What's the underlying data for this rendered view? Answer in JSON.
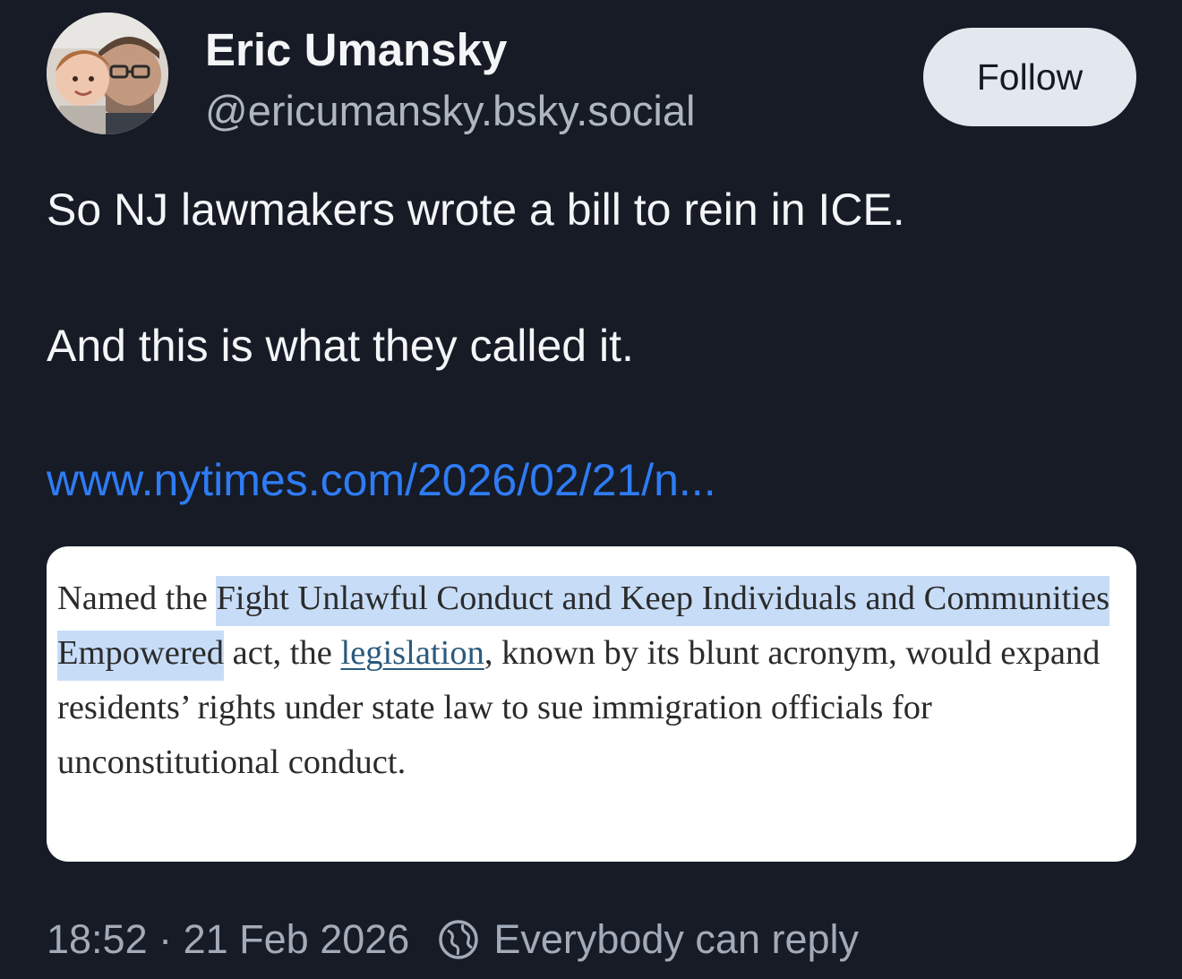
{
  "author": {
    "display_name": "Eric Umansky",
    "handle": "@ericumansky.bsky.social",
    "avatar_icon": "avatar-photo"
  },
  "follow_button": {
    "label": "Follow"
  },
  "post": {
    "line1": "So NJ lawmakers wrote a bill to rein in ICE.",
    "line2": "And this is what they called it.",
    "link_text": "www.nytimes.com/2026/02/21/n..."
  },
  "quote": {
    "prefix": "Named the ",
    "highlight": "Fight Unlawful Conduct and Keep Individuals and Communities Empowered",
    "middle": " act, the ",
    "link_word": "legislation",
    "suffix": ", known by its blunt acronym, would expand residents’ rights under state law to sue immigration officials for unconstitutional conduct."
  },
  "footer": {
    "timestamp": "18:52 · 21 Feb 2026",
    "reply_setting": "Everybody can reply",
    "reply_icon": "globe-icon"
  },
  "colors": {
    "background": "#161b26",
    "link": "#2f7cf4",
    "highlight": "#c7dcf7"
  }
}
